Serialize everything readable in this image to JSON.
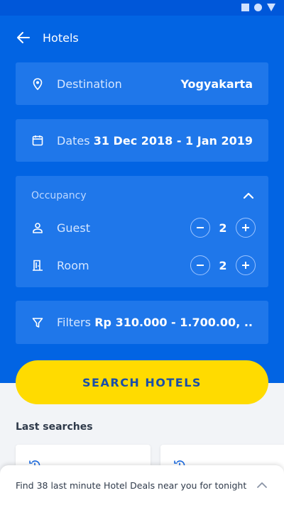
{
  "header": {
    "title": "Hotels"
  },
  "destination": {
    "label": "Destination",
    "value": "Yogyakarta"
  },
  "dates": {
    "label": "Dates",
    "value": "31 Dec 2018 - 1 Jan 2019"
  },
  "occupancy": {
    "title": "Occupancy",
    "guest": {
      "label": "Guest",
      "value": "2"
    },
    "room": {
      "label": "Room",
      "value": "2"
    }
  },
  "filters": {
    "label": "Filters",
    "value": "Rp 310.000 - 1.700.00, .."
  },
  "search_button": "SEARCH HOTELS",
  "last_searches": {
    "title": "Last searches"
  },
  "deals_banner": "Find 38 last minute Hotel Deals near you for tonight",
  "colors": {
    "primary": "#0264e3",
    "card": "#1f77ea",
    "accent": "#ffdb00",
    "button_text": "#1a4fa8"
  }
}
